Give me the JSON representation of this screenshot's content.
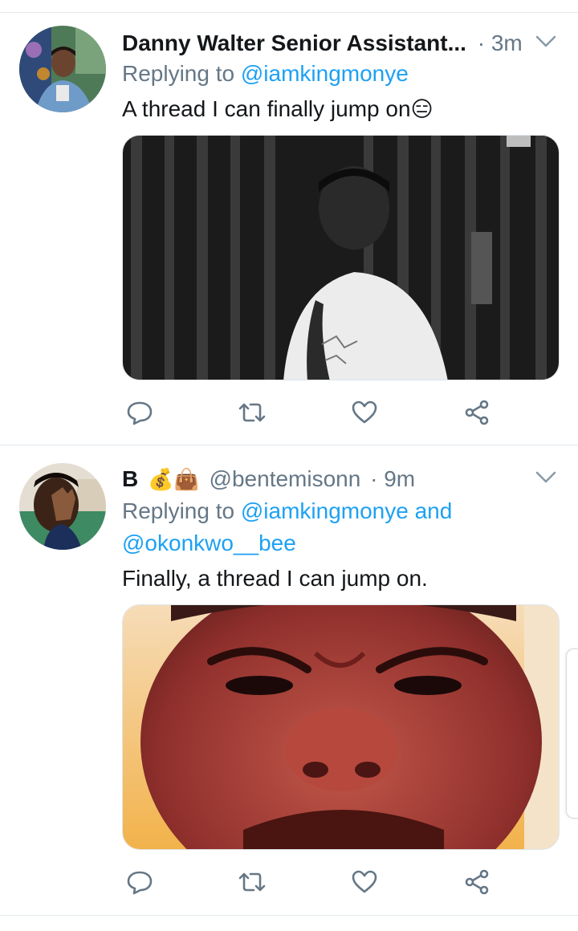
{
  "tweets": [
    {
      "name": "Danny Walter Senior Assistant...",
      "handle": "",
      "time": "3m",
      "replying_prefix": "Replying to",
      "replying_to": "@iamkingmonye",
      "replying_and": "",
      "replying_to_2": "",
      "text": "A thread I can finally jump on",
      "text_emoji": "😑",
      "media_description": "black-and-white photo of a man leaning against a dark door"
    },
    {
      "name": "B",
      "name_emojis": "💰👜",
      "handle": "@bentemisonn",
      "time": "9m",
      "replying_prefix": "Replying to",
      "replying_to": "@iamkingmonye",
      "replying_and": "and",
      "replying_to_2": "@okonkwo__bee",
      "text": "Finally, a thread I can jump on.",
      "media_description": "close-up photo of a man scrunching his face"
    }
  ],
  "separator": "·",
  "icons": {
    "reply": "reply-icon",
    "retweet": "retweet-icon",
    "like": "heart-icon",
    "share": "share-icon",
    "menu": "chevron-down-icon"
  },
  "colors": {
    "link": "#1da1f2",
    "muted": "#657786",
    "divider": "#e1e8ed"
  }
}
